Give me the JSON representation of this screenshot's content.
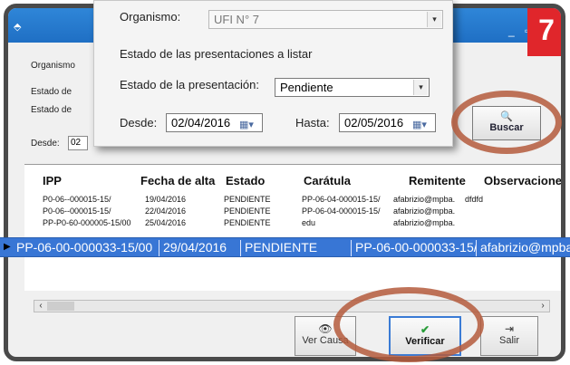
{
  "badge": "7",
  "window": {
    "minimize_glyph": "_",
    "maximize_glyph": "▫"
  },
  "behind_form": {
    "organismo_label": "Organismo",
    "estado_label_1": "Estado de",
    "estado_label_2": "Estado de",
    "desde_label": "Desde:",
    "desde_value": "02"
  },
  "zoom": {
    "organismo_label": "Organismo:",
    "organismo_value": "UFI N° 7",
    "section_title": "Estado de las presentaciones a listar",
    "estado_label": "Estado de la presentación:",
    "estado_value": "Pendiente",
    "desde_label": "Desde:",
    "desde_value": "02/04/2016",
    "hasta_label": "Hasta:",
    "hasta_value": "02/05/2016"
  },
  "buscar_label": "Buscar",
  "grid": {
    "headers": [
      "IPP",
      "Fecha de alta",
      "Estado",
      "Carátula",
      "Remitente",
      "Observaciones"
    ],
    "rows": [
      [
        "P0-06--000015-15/",
        "19/04/2016",
        "PENDIENTE",
        "PP-06-04-000015-15/",
        "afabrizio@mpba.",
        "dfdfd"
      ],
      [
        "P0-06--000015-15/",
        "22/04/2016",
        "PENDIENTE",
        "PP-06-04-000015-15/",
        "afabrizio@mpba.",
        ""
      ],
      [
        "PP-P0-60-000005-15/00",
        "25/04/2016",
        "PENDIENTE",
        "edu",
        "afabrizio@mpba.",
        ""
      ]
    ],
    "selected_row": [
      "PP-06-00-000033-15/00",
      "29/04/2016",
      "PENDIENTE",
      "PP-06-00-000033-15/",
      "afabrizio@mpba"
    ]
  },
  "actions": {
    "ver_causa": "Ver Causa",
    "verificar": "Verificar",
    "salir": "Salir"
  }
}
